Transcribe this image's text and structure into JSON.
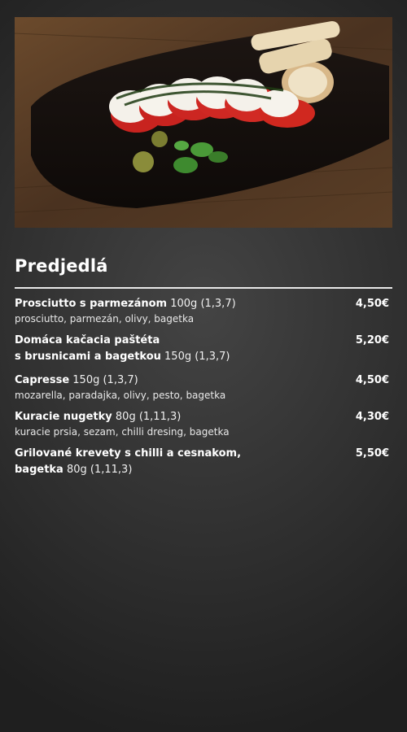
{
  "hero": {
    "image": "caprese-salad-photo"
  },
  "section": {
    "title": "Predjedlá"
  },
  "items": [
    {
      "name": "Prosciutto s parmezánom",
      "weight": " 100g (1,3,7)",
      "desc": "prosciutto, parmezán, olivy, bagetka",
      "price": "4,50€"
    },
    {
      "name_line1": "Domáca kačacia paštéta",
      "name": "s brusnicami a bagetkou",
      "weight": " 150g (1,3,7)",
      "price": "5,20€"
    },
    {
      "name": "Capresse",
      "weight": " 150g (1,3,7)",
      "desc": "mozarella, paradajka, olivy, pesto, bagetka",
      "price": "4,50€"
    },
    {
      "name": "Kuracie nugetky",
      "weight": " 80g (1,11,3)",
      "desc": "kuracie prsia, sezam, chilli dresing, bagetka",
      "price": "4,30€"
    },
    {
      "name_line1": "Grilované krevety s chilli a cesnakom,",
      "name": "bagetka",
      "weight": " 80g (1,11,3)",
      "price": "5,50€"
    }
  ]
}
